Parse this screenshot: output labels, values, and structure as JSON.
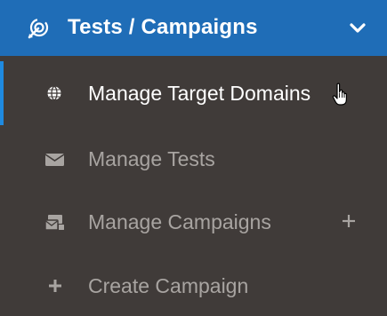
{
  "header": {
    "title": "Tests / Campaigns",
    "icon": "target-icon",
    "chevron": "chevron-down-icon",
    "background": "#1f6db7"
  },
  "menu": {
    "items": [
      {
        "label": "Manage Target Domains",
        "icon": "globe-icon",
        "active": true
      },
      {
        "label": "Manage Tests",
        "icon": "envelope-icon",
        "active": false
      },
      {
        "label": "Manage Campaigns",
        "icon": "campaigns-icon",
        "active": false,
        "expand": "+"
      },
      {
        "label": "Create Campaign",
        "icon": "plus-icon",
        "active": false
      }
    ]
  },
  "colors": {
    "background": "#403b39",
    "active_bar": "#1f8ae0",
    "active_text": "#ffffff",
    "inactive_text": "#a8a4a1"
  }
}
